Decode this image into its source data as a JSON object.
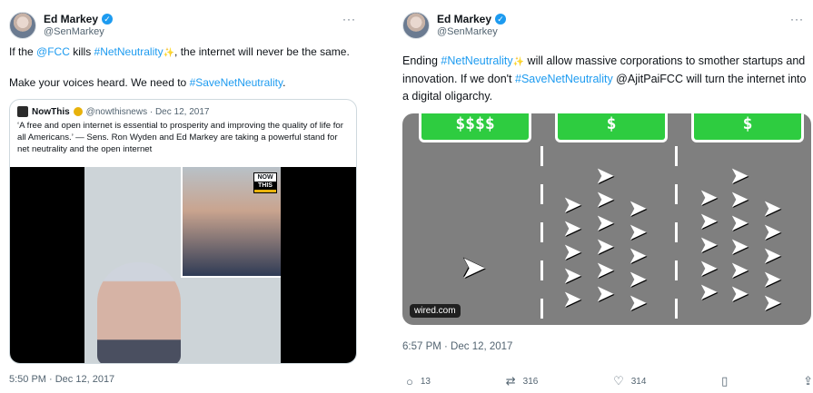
{
  "left": {
    "author": {
      "name": "Ed Markey",
      "handle": "@SenMarkey"
    },
    "more_label": "···",
    "text_parts": {
      "p1_a": "If the ",
      "p1_mention": "@FCC",
      "p1_b": " kills ",
      "p1_tag": "#NetNeutrality",
      "p1_sparkle": "✨",
      "p1_c": ", the internet will never be the same.",
      "p2_a": "Make your voices heard. We need to ",
      "p2_tag": "#SaveNetNeutrality",
      "p2_b": "."
    },
    "quote": {
      "name": "NowThis",
      "meta": "@nowthisnews · Dec 12, 2017",
      "text": "‘A free and open internet is essential to prosperity and improving the quality of life for all Americans.’ — Sens. Ron Wyden and Ed Markey are taking a powerful stand for net neutrality and the open internet",
      "badge_line1": "NOW",
      "badge_line2": "THIS"
    },
    "timestamp": "5:50 PM · Dec 12, 2017"
  },
  "right": {
    "author": {
      "name": "Ed Markey",
      "handle": "@SenMarkey"
    },
    "more_label": "···",
    "text_parts": {
      "a": "Ending ",
      "tag1": "#NetNeutrality",
      "sparkle": "✨",
      "b": " will allow massive corporations to smother startups and innovation. If we don't ",
      "tag2": "#SaveNetNeutrality",
      "c": " @AjitPaiFCC will turn the internet into a digital oligarchy."
    },
    "media": {
      "lane1": "$$$$",
      "lane2": "$",
      "lane3": "$",
      "source": "wired.com"
    },
    "timestamp": "6:57 PM · Dec 12, 2017",
    "actions": {
      "reply_icon": "reply-icon",
      "reply_count": "13",
      "retweet_icon": "retweet-icon",
      "retweet_count": "316",
      "like_icon": "heart-icon",
      "like_count": "314",
      "bookmark_icon": "bookmark-icon",
      "share_icon": "share-icon"
    }
  },
  "colors": {
    "accent": "#1d9bf0",
    "text": "#0f1419",
    "muted": "#536471",
    "border": "#cfd9de",
    "lane_green": "#2ecc40",
    "road_gray": "#7f7f7f"
  }
}
